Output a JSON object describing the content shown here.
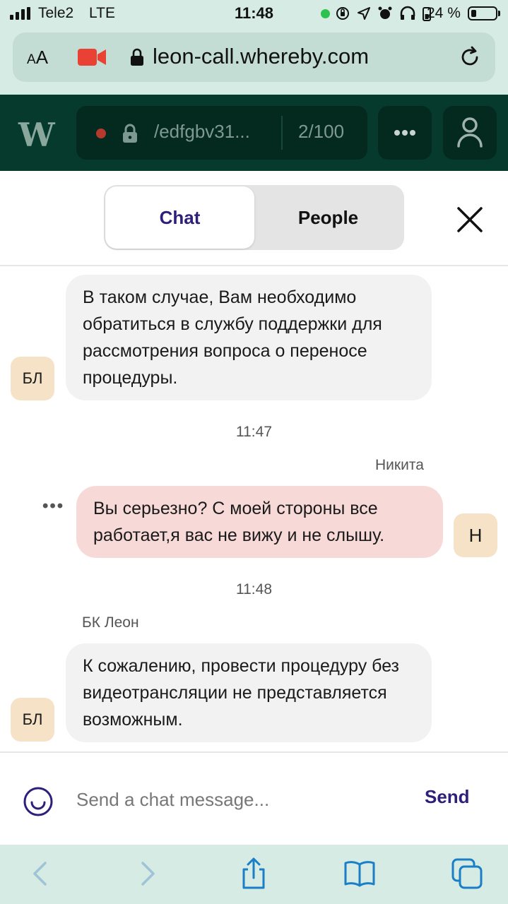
{
  "status_bar": {
    "carrier": "Tele2",
    "network": "LTE",
    "time": "11:48",
    "battery_percent": "24 %"
  },
  "browser": {
    "aa_label": "AA",
    "url": "leon-call.whereby.com"
  },
  "header": {
    "room_name": "/edfgbv31...",
    "participant_count": "2/100"
  },
  "tabs": {
    "chat": "Chat",
    "people": "People"
  },
  "messages": [
    {
      "type": "incoming",
      "avatar": "БЛ",
      "text": "В таком случае, Вам необходимо обратиться в службу поддержки для рассмотрения вопроса о переносе процедуры."
    },
    {
      "type": "timestamp",
      "text": "11:47"
    },
    {
      "type": "outgoing",
      "sender": "Никита",
      "avatar": "Н",
      "text": "Вы серьезно? С моей стороны все работает,я вас не вижу и не слышу."
    },
    {
      "type": "timestamp",
      "text": "11:48"
    },
    {
      "type": "incoming",
      "sender": "БК Леон",
      "avatar": "БЛ",
      "text": "К сожалению, провести процедуру без видеотрансляции не представляется возможным."
    }
  ],
  "compose": {
    "placeholder": "Send a chat message...",
    "send_label": "Send"
  },
  "colors": {
    "accent": "#2e1f7a",
    "header_bg": "#063a2d",
    "browser_bg": "#d5ebe4",
    "outgoing_bubble": "#f7d9d8",
    "incoming_bubble": "#f2f2f2",
    "avatar_bg": "#f6e2c7"
  }
}
